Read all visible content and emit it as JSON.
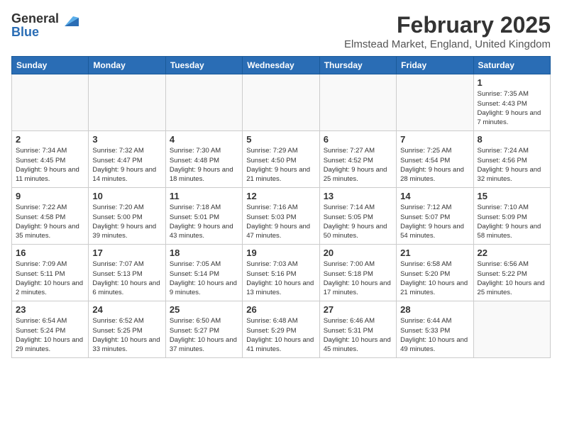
{
  "logo": {
    "general": "General",
    "blue": "Blue"
  },
  "title": {
    "month_year": "February 2025",
    "location": "Elmstead Market, England, United Kingdom"
  },
  "days_of_week": [
    "Sunday",
    "Monday",
    "Tuesday",
    "Wednesday",
    "Thursday",
    "Friday",
    "Saturday"
  ],
  "weeks": [
    [
      {
        "day": "",
        "info": ""
      },
      {
        "day": "",
        "info": ""
      },
      {
        "day": "",
        "info": ""
      },
      {
        "day": "",
        "info": ""
      },
      {
        "day": "",
        "info": ""
      },
      {
        "day": "",
        "info": ""
      },
      {
        "day": "1",
        "info": "Sunrise: 7:35 AM\nSunset: 4:43 PM\nDaylight: 9 hours and 7 minutes."
      }
    ],
    [
      {
        "day": "2",
        "info": "Sunrise: 7:34 AM\nSunset: 4:45 PM\nDaylight: 9 hours and 11 minutes."
      },
      {
        "day": "3",
        "info": "Sunrise: 7:32 AM\nSunset: 4:47 PM\nDaylight: 9 hours and 14 minutes."
      },
      {
        "day": "4",
        "info": "Sunrise: 7:30 AM\nSunset: 4:48 PM\nDaylight: 9 hours and 18 minutes."
      },
      {
        "day": "5",
        "info": "Sunrise: 7:29 AM\nSunset: 4:50 PM\nDaylight: 9 hours and 21 minutes."
      },
      {
        "day": "6",
        "info": "Sunrise: 7:27 AM\nSunset: 4:52 PM\nDaylight: 9 hours and 25 minutes."
      },
      {
        "day": "7",
        "info": "Sunrise: 7:25 AM\nSunset: 4:54 PM\nDaylight: 9 hours and 28 minutes."
      },
      {
        "day": "8",
        "info": "Sunrise: 7:24 AM\nSunset: 4:56 PM\nDaylight: 9 hours and 32 minutes."
      }
    ],
    [
      {
        "day": "9",
        "info": "Sunrise: 7:22 AM\nSunset: 4:58 PM\nDaylight: 9 hours and 35 minutes."
      },
      {
        "day": "10",
        "info": "Sunrise: 7:20 AM\nSunset: 5:00 PM\nDaylight: 9 hours and 39 minutes."
      },
      {
        "day": "11",
        "info": "Sunrise: 7:18 AM\nSunset: 5:01 PM\nDaylight: 9 hours and 43 minutes."
      },
      {
        "day": "12",
        "info": "Sunrise: 7:16 AM\nSunset: 5:03 PM\nDaylight: 9 hours and 47 minutes."
      },
      {
        "day": "13",
        "info": "Sunrise: 7:14 AM\nSunset: 5:05 PM\nDaylight: 9 hours and 50 minutes."
      },
      {
        "day": "14",
        "info": "Sunrise: 7:12 AM\nSunset: 5:07 PM\nDaylight: 9 hours and 54 minutes."
      },
      {
        "day": "15",
        "info": "Sunrise: 7:10 AM\nSunset: 5:09 PM\nDaylight: 9 hours and 58 minutes."
      }
    ],
    [
      {
        "day": "16",
        "info": "Sunrise: 7:09 AM\nSunset: 5:11 PM\nDaylight: 10 hours and 2 minutes."
      },
      {
        "day": "17",
        "info": "Sunrise: 7:07 AM\nSunset: 5:13 PM\nDaylight: 10 hours and 6 minutes."
      },
      {
        "day": "18",
        "info": "Sunrise: 7:05 AM\nSunset: 5:14 PM\nDaylight: 10 hours and 9 minutes."
      },
      {
        "day": "19",
        "info": "Sunrise: 7:03 AM\nSunset: 5:16 PM\nDaylight: 10 hours and 13 minutes."
      },
      {
        "day": "20",
        "info": "Sunrise: 7:00 AM\nSunset: 5:18 PM\nDaylight: 10 hours and 17 minutes."
      },
      {
        "day": "21",
        "info": "Sunrise: 6:58 AM\nSunset: 5:20 PM\nDaylight: 10 hours and 21 minutes."
      },
      {
        "day": "22",
        "info": "Sunrise: 6:56 AM\nSunset: 5:22 PM\nDaylight: 10 hours and 25 minutes."
      }
    ],
    [
      {
        "day": "23",
        "info": "Sunrise: 6:54 AM\nSunset: 5:24 PM\nDaylight: 10 hours and 29 minutes."
      },
      {
        "day": "24",
        "info": "Sunrise: 6:52 AM\nSunset: 5:25 PM\nDaylight: 10 hours and 33 minutes."
      },
      {
        "day": "25",
        "info": "Sunrise: 6:50 AM\nSunset: 5:27 PM\nDaylight: 10 hours and 37 minutes."
      },
      {
        "day": "26",
        "info": "Sunrise: 6:48 AM\nSunset: 5:29 PM\nDaylight: 10 hours and 41 minutes."
      },
      {
        "day": "27",
        "info": "Sunrise: 6:46 AM\nSunset: 5:31 PM\nDaylight: 10 hours and 45 minutes."
      },
      {
        "day": "28",
        "info": "Sunrise: 6:44 AM\nSunset: 5:33 PM\nDaylight: 10 hours and 49 minutes."
      },
      {
        "day": "",
        "info": ""
      }
    ]
  ]
}
